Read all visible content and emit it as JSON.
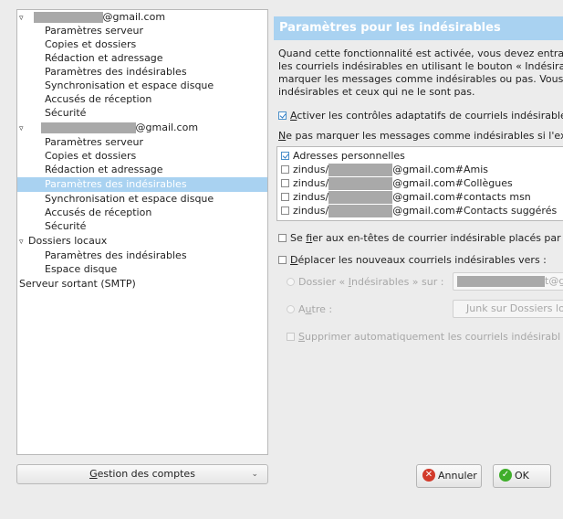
{
  "tree": {
    "account1": {
      "email_suffix": "@gmail.com",
      "items": [
        "Paramètres serveur",
        "Copies et dossiers",
        "Rédaction et adressage",
        "Paramètres des indésirables",
        "Synchronisation et espace disque",
        "Accusés de réception",
        "Sécurité"
      ]
    },
    "account2": {
      "email_suffix": "@gmail.com",
      "items": [
        "Paramètres serveur",
        "Copies et dossiers",
        "Rédaction et adressage",
        "Paramètres des indésirables",
        "Synchronisation et espace disque",
        "Accusés de réception",
        "Sécurité"
      ]
    },
    "local": {
      "label": "Dossiers locaux",
      "items": [
        "Paramètres des indésirables",
        "Espace disque"
      ]
    },
    "smtp": "Serveur sortant (SMTP)"
  },
  "manage_button": {
    "accel": "G",
    "rest": "estion des comptes"
  },
  "panel": {
    "title": "Paramètres pour les indésirables",
    "description": [
      "Quand cette fonctionnalité est activée, vous devez entraîne",
      "les courriels indésirables en utilisant le bouton « Indésirabl",
      "marquer les messages comme indésirables ou pas. Vous de",
      "indésirables et ceux qui ne le sont pas."
    ],
    "adaptive": {
      "accel": "A",
      "rest": "ctiver les contrôles adaptatifs de courriels indésirables",
      "checked": true
    },
    "whitelist_label": {
      "accel": "N",
      "rest": "e pas marquer les messages comme indésirables si l'expé"
    },
    "whitelist": [
      {
        "prefix": "",
        "suffix": "Adresses personnelles",
        "checked": true
      },
      {
        "prefix": "zindus/",
        "suffix": "@gmail.com#Amis",
        "checked": false
      },
      {
        "prefix": "zindus/",
        "suffix": "@gmail.com#Collègues",
        "checked": false
      },
      {
        "prefix": "zindus/",
        "suffix": "@gmail.com#contacts msn",
        "checked": false
      },
      {
        "prefix": "zindus/",
        "suffix": "@gmail.com#Contacts suggérés",
        "checked": false
      }
    ],
    "trust_headers": {
      "pre": "Se ",
      "accel": "f",
      "rest": "ier aux en-têtes de courrier indésirable placés par :",
      "checked": false
    },
    "move": {
      "accel": "D",
      "rest": "éplacer les nouveaux courriels indésirables vers :",
      "checked": false
    },
    "folder_radio": {
      "pre": "Dossier « ",
      "accel": "I",
      "rest": "ndésirables » sur :",
      "field_value": "t@g"
    },
    "other_radio": {
      "pre": "A",
      "accel": "u",
      "rest": "tre :",
      "field_value": "Junk sur Dossiers loca"
    },
    "auto_delete": {
      "accel": "S",
      "rest": "upprimer automatiquement les courriels indésirabl",
      "checked": false
    }
  },
  "buttons": {
    "cancel": "Annuler",
    "ok": "OK"
  },
  "colors": {
    "selection": "#a9d2f1",
    "title_bg": "#a9d2f1",
    "cancel_icon": "#d23a2a",
    "ok_icon": "#3fae2a"
  }
}
